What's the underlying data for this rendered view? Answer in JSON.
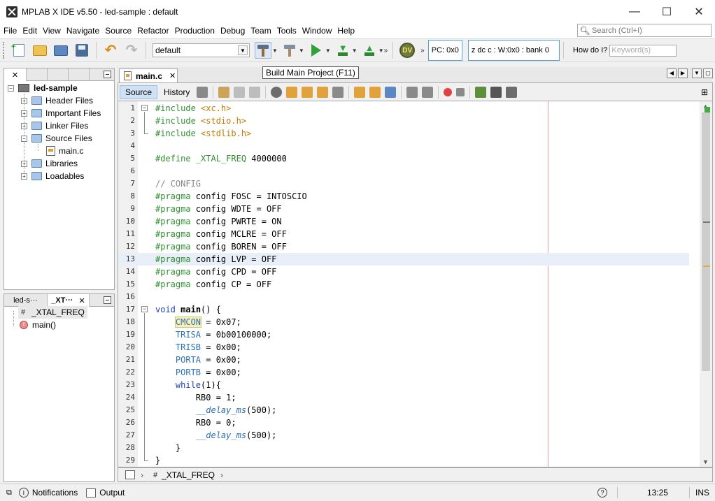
{
  "window": {
    "title": "MPLAB X IDE v5.50 - led-sample : default",
    "minimize": "—",
    "maximize": "☐",
    "close": "✕"
  },
  "menu": [
    "File",
    "Edit",
    "View",
    "Navigate",
    "Source",
    "Refactor",
    "Production",
    "Debug",
    "Team",
    "Tools",
    "Window",
    "Help"
  ],
  "search": {
    "placeholder": "Search (Ctrl+I)"
  },
  "toolbar": {
    "config": "default",
    "pc": "PC: 0x0",
    "status_regs": "z dc c  : W:0x0 : bank 0",
    "howdoi_label": "How do I?",
    "howdoi_placeholder": "Keyword(s)",
    "tooltip": "Build Main Project (F11)"
  },
  "projects_panel": {
    "tabs": [
      "✕",
      "",
      "",
      ""
    ],
    "tree": [
      {
        "label": "led-sample",
        "level": 0,
        "type": "project",
        "bold": true
      },
      {
        "label": "Header Files",
        "level": 1,
        "type": "folder"
      },
      {
        "label": "Important Files",
        "level": 1,
        "type": "folder"
      },
      {
        "label": "Linker Files",
        "level": 1,
        "type": "folder"
      },
      {
        "label": "Source Files",
        "level": 1,
        "type": "folder",
        "open": true
      },
      {
        "label": "main.c",
        "level": 2,
        "type": "file"
      },
      {
        "label": "Libraries",
        "level": 1,
        "type": "folder"
      },
      {
        "label": "Loadables",
        "level": 1,
        "type": "folder"
      }
    ]
  },
  "navigator_panel": {
    "tabs": [
      "led-s···",
      "_XT···"
    ],
    "close": "✕",
    "items": [
      {
        "label": "_XTAL_FREQ",
        "type": "macro"
      },
      {
        "label": "main()",
        "type": "function"
      }
    ]
  },
  "editor": {
    "tab_label": "main.c",
    "tab_close": "✕",
    "source_tab": "Source",
    "history_tab": "History",
    "highlighted_line": 13,
    "lines": [
      "#include <xc.h>",
      "#include <stdio.h>",
      "#include <stdlib.h>",
      "",
      "#define _XTAL_FREQ 4000000",
      "",
      "// CONFIG",
      "#pragma config FOSC = INTOSCIO",
      "#pragma config WDTE = OFF",
      "#pragma config PWRTE = ON",
      "#pragma config MCLRE = OFF",
      "#pragma config BOREN = OFF",
      "#pragma config LVP = OFF",
      "#pragma config CPD = OFF",
      "#pragma config CP = OFF",
      "",
      "void main() {",
      "    CMCON = 0x07;",
      "    TRISA = 0b00100000;",
      "    TRISB = 0x00;",
      "    PORTA = 0x00;",
      "    PORTB = 0x00;",
      "    while(1){",
      "        RB0 = 1;",
      "        __delay_ms(500);",
      "        RB0 = 0;",
      "        __delay_ms(500);",
      "    }",
      "}"
    ],
    "breadcrumb": "_XTAL_FREQ"
  },
  "statusbar": {
    "notifications": "Notifications",
    "output": "Output",
    "position": "13:25",
    "mode": "INS"
  }
}
